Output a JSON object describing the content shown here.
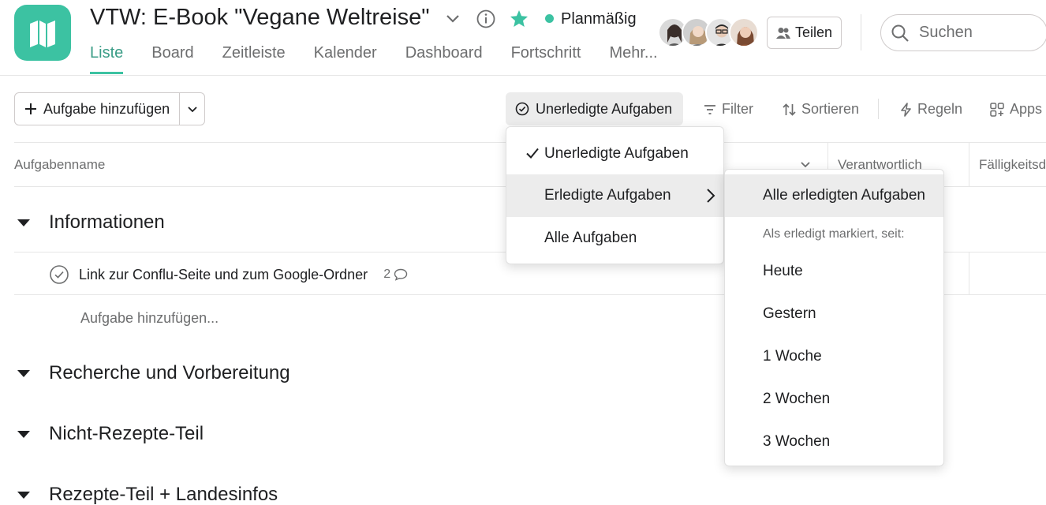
{
  "project": {
    "title": "VTW: E-Book \"Vegane Weltreise\"",
    "status": "Planmäßig",
    "status_color": "#3cc2a2",
    "icon": "map-icon"
  },
  "tabs": [
    {
      "label": "Liste",
      "active": true
    },
    {
      "label": "Board"
    },
    {
      "label": "Zeitleiste"
    },
    {
      "label": "Kalender"
    },
    {
      "label": "Dashboard"
    },
    {
      "label": "Fortschritt"
    },
    {
      "label": "Mehr..."
    }
  ],
  "header": {
    "share_label": "Teilen",
    "search_placeholder": "Suchen"
  },
  "toolbar": {
    "add_task_label": "Aufgabe hinzufügen",
    "completion_filter_label": "Unerledigte Aufgaben",
    "filter_label": "Filter",
    "sort_label": "Sortieren",
    "rules_label": "Regeln",
    "apps_label": "Apps"
  },
  "columns": {
    "task_name": "Aufgabenname",
    "assignee": "Verantwortlich",
    "due_date": "Fälligkeitsd"
  },
  "sections": [
    {
      "name": "Informationen"
    },
    {
      "name": "Recherche und Vorbereitung"
    },
    {
      "name": "Nicht-Rezepte-Teil"
    },
    {
      "name": "Rezepte-Teil + Landesinfos"
    }
  ],
  "tasks": [
    {
      "name": "Link zur Conflu-Seite und zum Google-Ordner",
      "comments": "2"
    }
  ],
  "add_subtask_label": "Aufgabe hinzufügen...",
  "completion_menu": {
    "items": [
      {
        "label": "Unerledigte Aufgaben",
        "checked": true
      },
      {
        "label": "Erledigte Aufgaben",
        "has_submenu": true
      },
      {
        "label": "Alle Aufgaben"
      }
    ]
  },
  "completed_submenu": {
    "all_label": "Alle erledigten Aufgaben",
    "section_label": "Als erledigt markiert, seit:",
    "items": [
      "Heute",
      "Gestern",
      "1 Woche",
      "2 Wochen",
      "3 Wochen"
    ]
  },
  "colors": {
    "accent": "#3cc2a2",
    "accent_text": "#3b9d87",
    "star": "#3cc2a2"
  }
}
